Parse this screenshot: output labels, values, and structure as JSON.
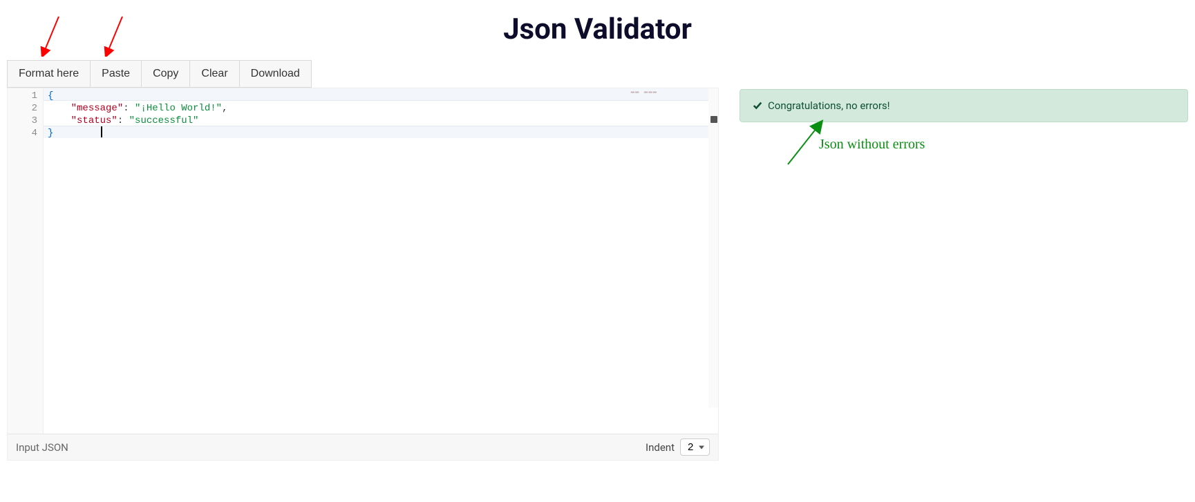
{
  "title": "Json Validator",
  "toolbar": {
    "format": "Format here",
    "paste": "Paste",
    "copy": "Copy",
    "clear": "Clear",
    "download": "Download"
  },
  "editor": {
    "line_numbers": [
      "1",
      "2",
      "3",
      "4"
    ],
    "code_tokens": [
      [
        {
          "t": "brace",
          "v": "{"
        }
      ],
      [
        {
          "t": "indent",
          "v": "    "
        },
        {
          "t": "key",
          "v": "\"message\""
        },
        {
          "t": "punc",
          "v": ": "
        },
        {
          "t": "str",
          "v": "\"¡Hello World!\""
        },
        {
          "t": "punc",
          "v": ","
        }
      ],
      [
        {
          "t": "indent",
          "v": "    "
        },
        {
          "t": "key",
          "v": "\"status\""
        },
        {
          "t": "punc",
          "v": ": "
        },
        {
          "t": "str",
          "v": "\"successful\""
        }
      ],
      [
        {
          "t": "brace",
          "v": "}"
        }
      ]
    ],
    "footer_label": "Input JSON",
    "indent_label": "Indent",
    "indent_value": "2"
  },
  "result": {
    "success_message": "Congratulations, no errors!"
  },
  "annotations": {
    "green_label": "Json without errors"
  }
}
